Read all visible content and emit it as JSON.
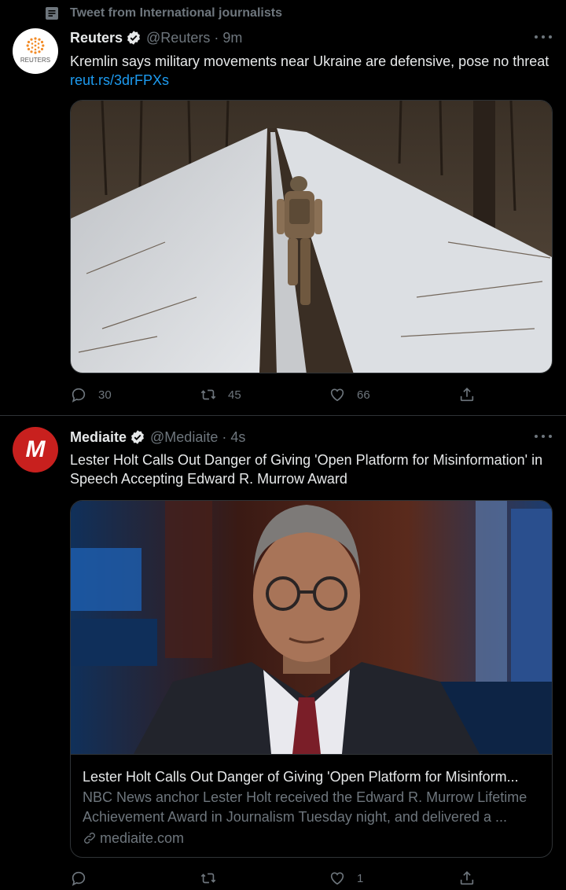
{
  "context": {
    "label": "Tweet from International journalists",
    "icon": "list-icon"
  },
  "tweets": [
    {
      "name": "Reuters",
      "handle": "@Reuters",
      "separator": "·",
      "time": "9m",
      "avatar_label": "REUTERS",
      "text": "Kremlin says military movements near Ukraine are defensive, pose no threat ",
      "link": "reut.rs/3drFPXs",
      "replies": "30",
      "retweets": "45",
      "likes": "66"
    },
    {
      "name": "Mediaite",
      "handle": "@Mediaite",
      "separator": "·",
      "time": "4s",
      "avatar_label": "M",
      "text": "Lester Holt Calls Out Danger of Giving 'Open Platform for Misinformation' in Speech Accepting Edward R. Murrow Award",
      "card": {
        "title": "Lester Holt Calls Out Danger of Giving 'Open Platform for Misinform...",
        "description": "NBC News anchor Lester Holt received the Edward R. Murrow Lifetime Achievement Award in Journalism Tuesday night, and delivered a ...",
        "domain": "mediaite.com"
      },
      "replies": "",
      "retweets": "",
      "likes": "1"
    }
  ],
  "colors": {
    "background": "#000000",
    "accent": "#1d9bf0",
    "muted": "#6e767d",
    "mediaite_red": "#c8201e"
  }
}
